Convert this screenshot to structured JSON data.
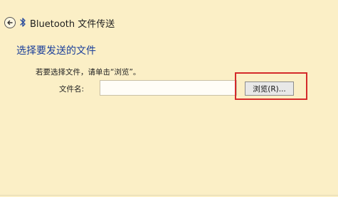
{
  "window": {
    "title": "Bluetooth 文件传送",
    "back_icon": "back-arrow-icon",
    "bluetooth_icon": "bluetooth-icon"
  },
  "content": {
    "heading": "选择要发送的文件",
    "hint": "若要选择文件，请单击“浏览”。",
    "file_label": "文件名:",
    "file_value": "",
    "browse_label": "浏览(R)..."
  },
  "colors": {
    "background": "#fbefc6",
    "heading": "#1b3f9a",
    "highlight": "#d42a2a"
  }
}
